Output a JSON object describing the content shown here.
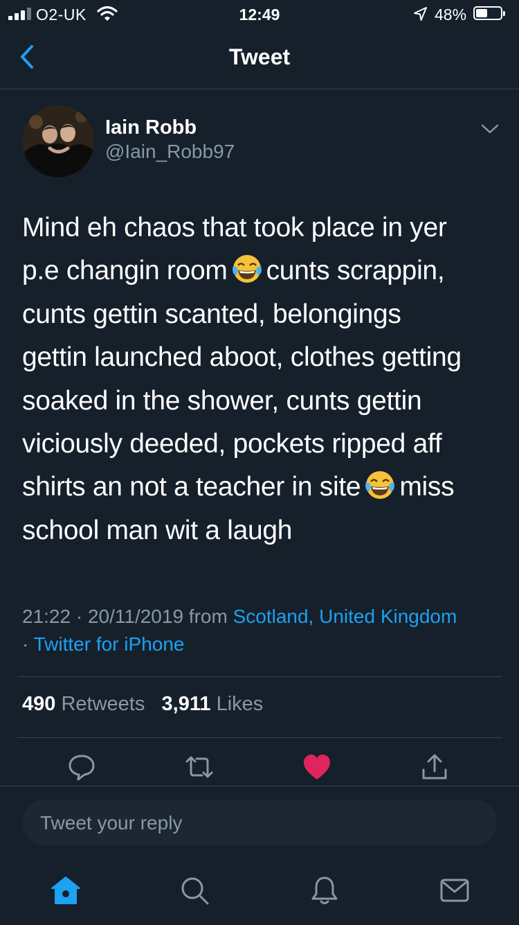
{
  "status_bar": {
    "carrier": "O2-UK",
    "time": "12:49",
    "battery_percent": "48%",
    "battery_level": 0.48,
    "icons": [
      "signal-icon",
      "wifi-icon",
      "location-arrow-icon",
      "battery-icon"
    ]
  },
  "header": {
    "title": "Tweet",
    "back_icon": "back-chevron-icon"
  },
  "tweet": {
    "author_name": "Iain Robb",
    "author_handle": "@Iain_Robb97",
    "lines": [
      "Mind eh chaos that took place in yer",
      [
        "p.e changin room",
        "cunts scrappin,"
      ],
      "cunts gettin scanted, belongings",
      "gettin launched aboot, clothes getting",
      "soaked in the shower, cunts gettin",
      "viciously deeded, pockets ripped aff",
      [
        "shirts an not a teacher in site",
        "miss"
      ],
      "school man wit a laugh"
    ],
    "emoji_name": "face-with-tears-of-joy",
    "timestamp": "21:22 · 20/11/2019 from ",
    "location": "Scotland, United Kingdom",
    "separator": "· ",
    "source": "Twitter for iPhone"
  },
  "stats": {
    "retweets_count": "490",
    "retweets_label": "Retweets",
    "likes_count": "3,911",
    "likes_label": "Likes"
  },
  "actions": [
    "reply-icon",
    "retweet-icon",
    "like-icon",
    "share-icon"
  ],
  "reply": {
    "placeholder": "Tweet your reply"
  },
  "tab_bar": [
    "home-icon",
    "search-icon",
    "notifications-icon",
    "messages-icon"
  ],
  "colors": {
    "background": "#15202b",
    "accent": "#1da1f2",
    "secondary_text": "#8899a6",
    "like": "#e0245e",
    "divider": "#38444d"
  }
}
